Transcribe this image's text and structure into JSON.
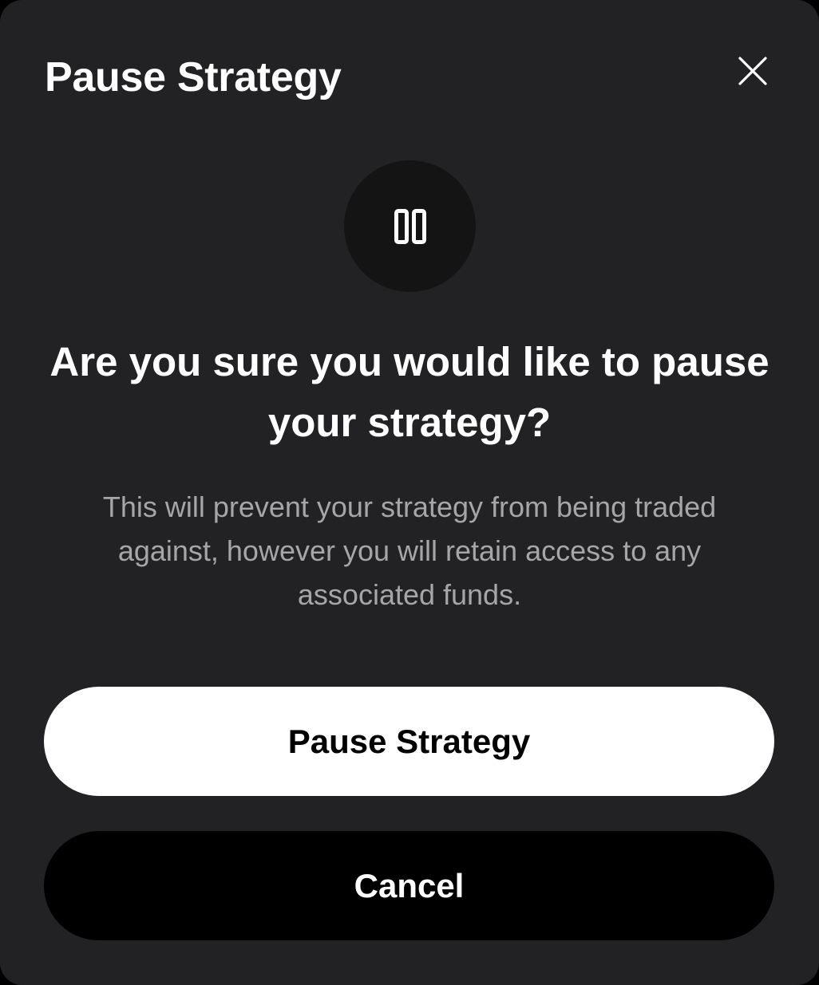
{
  "dialog": {
    "title": "Pause Strategy",
    "close_icon": "close-icon",
    "status_icon": "pause-icon",
    "headline": "Are you sure you would like to pause your strategy?",
    "description": "This will prevent your strategy from being traded against, however you will retain access to any associated funds.",
    "primary_button_label": "Pause Strategy",
    "secondary_button_label": "Cancel"
  },
  "colors": {
    "modal_background": "#222224",
    "icon_circle": "#141414",
    "primary_button": "#ffffff",
    "secondary_button": "#000000",
    "description_text": "#a6a6a8"
  }
}
